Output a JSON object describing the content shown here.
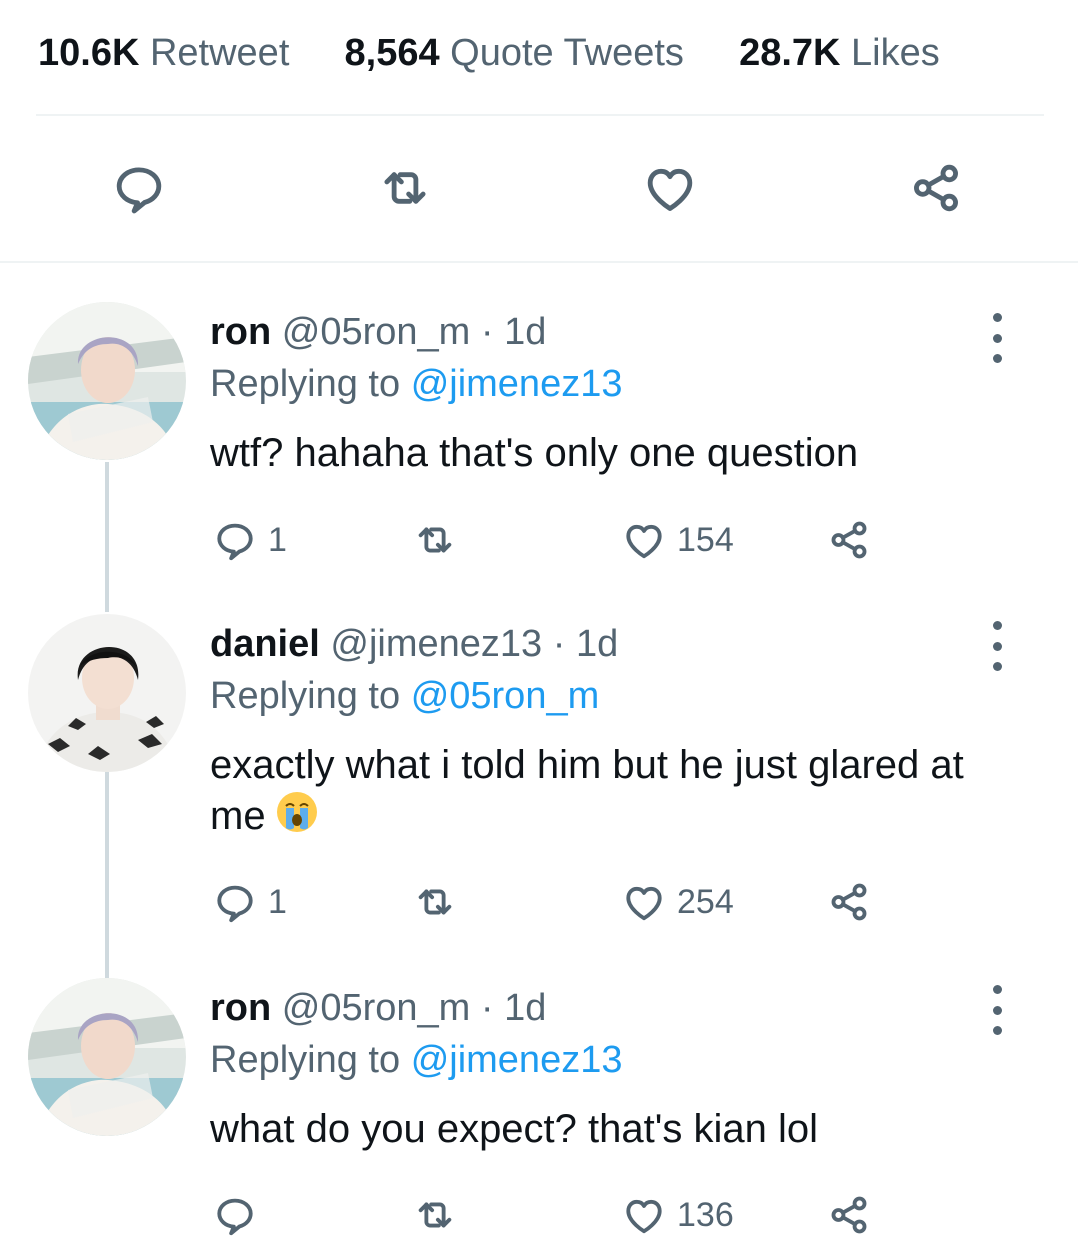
{
  "stats": {
    "retweets_count": "10.6K",
    "retweets_label": "Retweet",
    "quotes_count": "8,564",
    "quotes_label": "Quote Tweets",
    "likes_count": "28.7K",
    "likes_label": "Likes"
  },
  "main_actions": {
    "icons": [
      "reply-icon",
      "retweet-icon",
      "like-icon",
      "share-icon"
    ]
  },
  "replies": [
    {
      "name": "ron",
      "handle": "@05ron_m",
      "separator": "·",
      "time": "1d",
      "replying_prefix": "Replying to",
      "replying_to": "@jimenez13",
      "text": "wtf? hahaha that's only one question",
      "reply_count": "1",
      "retweet_count": "",
      "like_count": "154"
    },
    {
      "name": "daniel",
      "handle": "@jimenez13",
      "separator": "·",
      "time": "1d",
      "replying_prefix": "Replying to",
      "replying_to": "@05ron_m",
      "text": "exactly what i told him but he just glared at me",
      "emoji": "loudly-crying-face",
      "reply_count": "1",
      "retweet_count": "",
      "like_count": "254"
    },
    {
      "name": "ron",
      "handle": "@05ron_m",
      "separator": "·",
      "time": "1d",
      "replying_prefix": "Replying to",
      "replying_to": "@jimenez13",
      "text": "what do you expect? that's kian lol",
      "reply_count": "",
      "retweet_count": "",
      "like_count": "136"
    }
  ],
  "colors": {
    "text": "#0f1419",
    "secondary": "#536471",
    "accent": "#1d9bf0",
    "divider": "#eff3f4",
    "thread_line": "#cfd9de"
  }
}
